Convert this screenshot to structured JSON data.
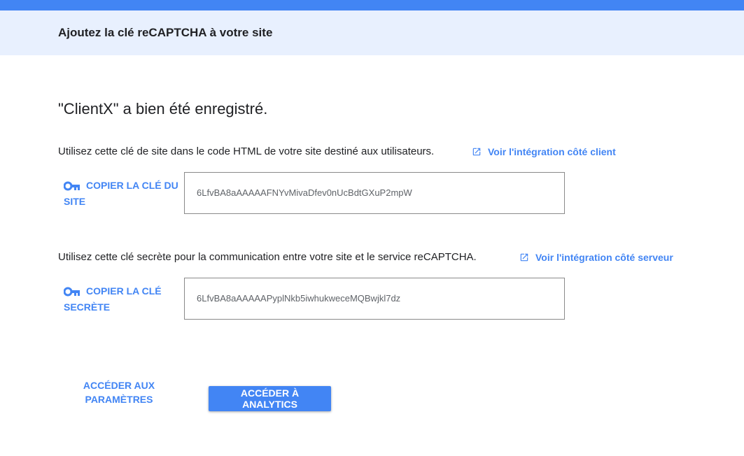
{
  "header": {
    "title": "Ajoutez la clé reCAPTCHA à votre site"
  },
  "main": {
    "success_message": "\"ClientX\" a bien été enregistré.",
    "site_key": {
      "description": "Utilisez cette clé de site dans le code HTML de votre site destiné aux utilisateurs.",
      "link_label": "Voir l'intégration côté client",
      "copy_label": "COPIER LA CLÉ DU SITE",
      "value": "6LfvBA8aAAAAAFNYvMivaDfev0nUcBdtGXuP2mpW"
    },
    "secret_key": {
      "description": "Utilisez cette clé secrète pour la communication entre votre site et le service reCAPTCHA.",
      "link_label": "Voir l'intégration côté serveur",
      "copy_label": "COPIER LA CLÉ SECRÈTE",
      "value": "6LfvBA8aAAAAAPyplNkb5iwhukweceMQBwjkl7dz"
    }
  },
  "footer": {
    "settings_label": "ACCÉDER AUX PARAMÈTRES",
    "analytics_label": "ACCÉDER À ANALYTICS"
  },
  "icons": {
    "key": "key-icon",
    "external_link": "open-in-new-icon"
  },
  "colors": {
    "accent": "#4285f4",
    "header_band": "#e8f0fe"
  }
}
